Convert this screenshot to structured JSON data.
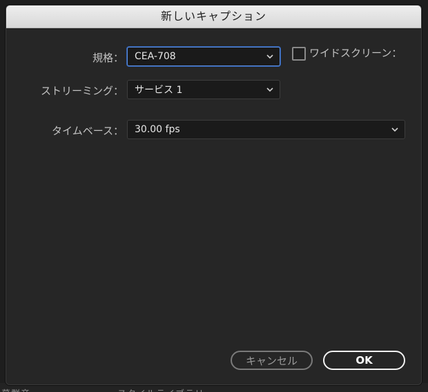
{
  "dialog": {
    "title": "新しいキャプション"
  },
  "form": {
    "standard": {
      "label": "規格：",
      "value": "CEA-708"
    },
    "widescreen": {
      "label": "ワイドスクリーン：",
      "checked": false
    },
    "stream": {
      "label": "ストリーミング：",
      "value": "サービス 1"
    },
    "timebase": {
      "label": "タイムベース：",
      "value": "30.00 fps"
    }
  },
  "buttons": {
    "cancel_label": "キャンセル",
    "ok_label": "OK"
  },
  "background_panel": {
    "items": [
      "募群音・・・",
      "スタイルライブラリ",
      "・・・"
    ]
  },
  "icons": {
    "dropdown": "chevron-down-icon",
    "checkbox": "checkbox-unchecked"
  },
  "colors": {
    "dialog_bg": "#262626",
    "field_bg": "#1a1a1a",
    "focus_ring": "#5b8ad6",
    "titlebar": "#e3e3e3"
  }
}
